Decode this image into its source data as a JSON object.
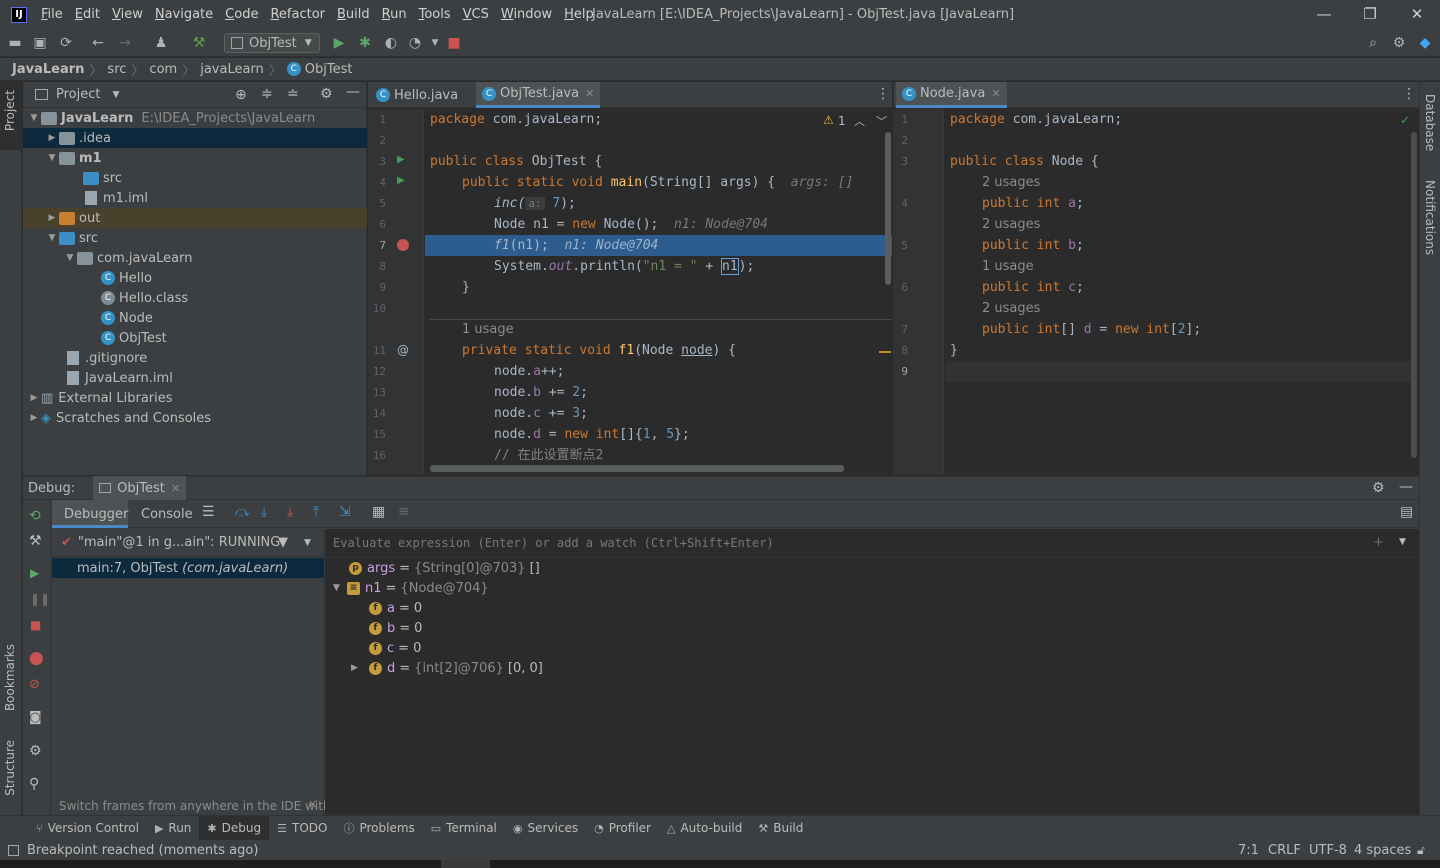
{
  "menu": [
    "File",
    "Edit",
    "View",
    "Navigate",
    "Code",
    "Refactor",
    "Build",
    "Run",
    "Tools",
    "VCS",
    "Window",
    "Help"
  ],
  "window_title": "JavaLearn [E:\\IDEA_Projects\\JavaLearn] - ObjTest.java [JavaLearn]",
  "toolbar": {
    "run_config": "ObjTest"
  },
  "breadcrumb": [
    "JavaLearn",
    "src",
    "com",
    "javaLearn",
    "ObjTest"
  ],
  "left_stripe": {
    "project": "Project",
    "bookmarks": "Bookmarks",
    "structure": "Structure"
  },
  "right_stripe": {
    "database": "Database",
    "notifications": "Notifications"
  },
  "project": {
    "header": "Project",
    "root_name": "JavaLearn",
    "root_path": "E:\\IDEA_Projects\\JavaLearn",
    "items": [
      {
        "label": ".idea"
      },
      {
        "label": "m1"
      },
      {
        "label": "src"
      },
      {
        "label": "m1.iml"
      },
      {
        "label": "out"
      },
      {
        "label": "src"
      },
      {
        "label": "com.javaLearn"
      },
      {
        "label": "Hello"
      },
      {
        "label": "Hello.class"
      },
      {
        "label": "Node"
      },
      {
        "label": "ObjTest"
      },
      {
        "label": ".gitignore"
      },
      {
        "label": "JavaLearn.iml"
      },
      {
        "label": "External Libraries"
      },
      {
        "label": "Scratches and Consoles"
      }
    ]
  },
  "editor1": {
    "tabs": [
      "Hello.java",
      "ObjTest.java"
    ],
    "warning_count": "1",
    "line_numbers": [
      "1",
      "2",
      "3",
      "4",
      "5",
      "6",
      "7",
      "8",
      "9",
      "10",
      "11",
      "12",
      "13",
      "14",
      "15",
      "16"
    ],
    "l1": {
      "kw": "package",
      "rest": " com.javaLearn;"
    },
    "l3": {
      "kw": "public class",
      "rest": " ObjTest {"
    },
    "l4": {
      "kw": "public static void",
      "fn": "main",
      "rest": "(String[] args) {",
      "hint": "args: []"
    },
    "l5": {
      "call": "inc(",
      "param": "a:",
      "num": "7",
      "end": ");"
    },
    "l6": {
      "a": "Node n1 = ",
      "kw": "new",
      "b": " Node();",
      "hint": "n1: Node@704"
    },
    "l7": {
      "call": "f1",
      "rest": "(n1);",
      "hint": "n1: Node@704"
    },
    "l8": {
      "a": "System.",
      "out": "out",
      "b": ".println(",
      "str": "\"n1 = \"",
      "c": " + ",
      "box": "n1",
      "d": ");"
    },
    "l9": "}",
    "usage": "1 usage",
    "l11": {
      "kw": "private static void",
      "fn": "f1",
      "rest": "(Node ",
      "param": "node",
      "end": ") {"
    },
    "l12": {
      "a": "node.",
      "f": "a",
      "b": "++;"
    },
    "l13": {
      "a": "node.",
      "f": "b",
      "b": " += ",
      "n": "2",
      "c": ";"
    },
    "l14": {
      "a": "node.",
      "f": "c",
      "b": " += ",
      "n": "3",
      "c": ";"
    },
    "l15": {
      "a": "node.",
      "f": "d",
      "b": " = ",
      "kw": "new",
      "k2": " int",
      "c": "[]{",
      "n1": "1",
      "d": ", ",
      "n2": "5",
      "e": "};"
    },
    "l16": "// 在此设置断点2"
  },
  "editor2": {
    "tab": "Node.java",
    "line_numbers": [
      "1",
      "2",
      "3",
      "4",
      "5",
      "6",
      "7",
      "8",
      "9"
    ],
    "l1": {
      "kw": "package",
      "rest": " com.javaLearn;"
    },
    "l3": {
      "kw": "public class",
      "rest": " Node {"
    },
    "u1": "2 usages",
    "l4": {
      "kw": "public int",
      "f": "a",
      "end": ";"
    },
    "u2": "2 usages",
    "l5": {
      "kw": "public int",
      "f": "b",
      "end": ";"
    },
    "u3": "1 usage",
    "l6": {
      "kw": "public int",
      "f": "c",
      "end": ";"
    },
    "u4": "2 usages",
    "l7": {
      "kw": "public int",
      "a": "[] ",
      "f": "d",
      "b": " = ",
      "kw2": "new",
      "k3": " int",
      "c": "[",
      "n": "2",
      "d": "];"
    },
    "l8": "}"
  },
  "debug": {
    "label": "Debug:",
    "session_tab": "ObjTest",
    "tabs": [
      "Debugger",
      "Console"
    ],
    "thread": "\"main\"@1 in g...ain\": RUNNING",
    "frame_main": "main:7, ObjTest",
    "frame_pkg": "(com.javaLearn)",
    "hint": "Switch frames from anywhere in the IDE with...",
    "eval_placeholder": "Evaluate expression (Enter) or add a watch (Ctrl+Shift+Enter)",
    "vars": [
      {
        "icon": "p",
        "name": "args",
        "type": "{String[0]@703}",
        "value": "[]"
      },
      {
        "icon": "≡",
        "name": "n1",
        "type": "{Node@704}",
        "value": ""
      },
      {
        "icon": "f",
        "name": "a",
        "type": "",
        "value": "0"
      },
      {
        "icon": "f",
        "name": "b",
        "type": "",
        "value": "0"
      },
      {
        "icon": "f",
        "name": "c",
        "type": "",
        "value": "0"
      },
      {
        "icon": "f",
        "name": "d",
        "type": "{int[2]@706}",
        "value": "[0, 0]"
      }
    ]
  },
  "toolwindows": [
    "Version Control",
    "Run",
    "Debug",
    "TODO",
    "Problems",
    "Terminal",
    "Services",
    "Profiler",
    "Auto-build",
    "Build"
  ],
  "status": {
    "message": "Breakpoint reached (moments ago)",
    "position": "7:1",
    "line_sep": "CRLF",
    "encoding": "UTF-8",
    "indent": "4 spaces"
  }
}
